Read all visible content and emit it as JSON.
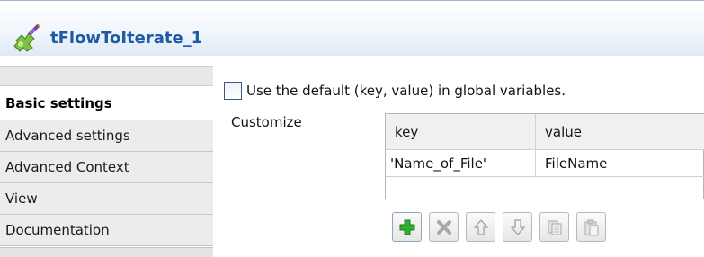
{
  "component": {
    "title": "tFlowToIterate_1",
    "icon": "component-puzzle-icon"
  },
  "sidebar": {
    "items": [
      {
        "label": "Basic settings",
        "active": true
      },
      {
        "label": "Advanced settings",
        "active": false
      },
      {
        "label": "Advanced Context",
        "active": false
      },
      {
        "label": "View",
        "active": false
      },
      {
        "label": "Documentation",
        "active": false
      }
    ]
  },
  "basic": {
    "use_default_label": "Use the default (key, value) in global variables.",
    "use_default_checked": false,
    "customize_label": "Customize"
  },
  "table": {
    "headers": [
      "key",
      "value"
    ],
    "rows": [
      {
        "key": "'Name_of_File'",
        "value": "FileName"
      }
    ]
  },
  "toolbar": {
    "buttons": [
      {
        "name": "add-icon",
        "enabled": true
      },
      {
        "name": "delete-icon",
        "enabled": false
      },
      {
        "name": "move-up-icon",
        "enabled": false
      },
      {
        "name": "move-down-icon",
        "enabled": false
      },
      {
        "name": "copy-icon",
        "enabled": false
      },
      {
        "name": "paste-icon",
        "enabled": false
      }
    ]
  },
  "colors": {
    "title": "#1e5aa5",
    "add_green": "#2fae2f",
    "disabled_gray": "#b0b0b0"
  }
}
